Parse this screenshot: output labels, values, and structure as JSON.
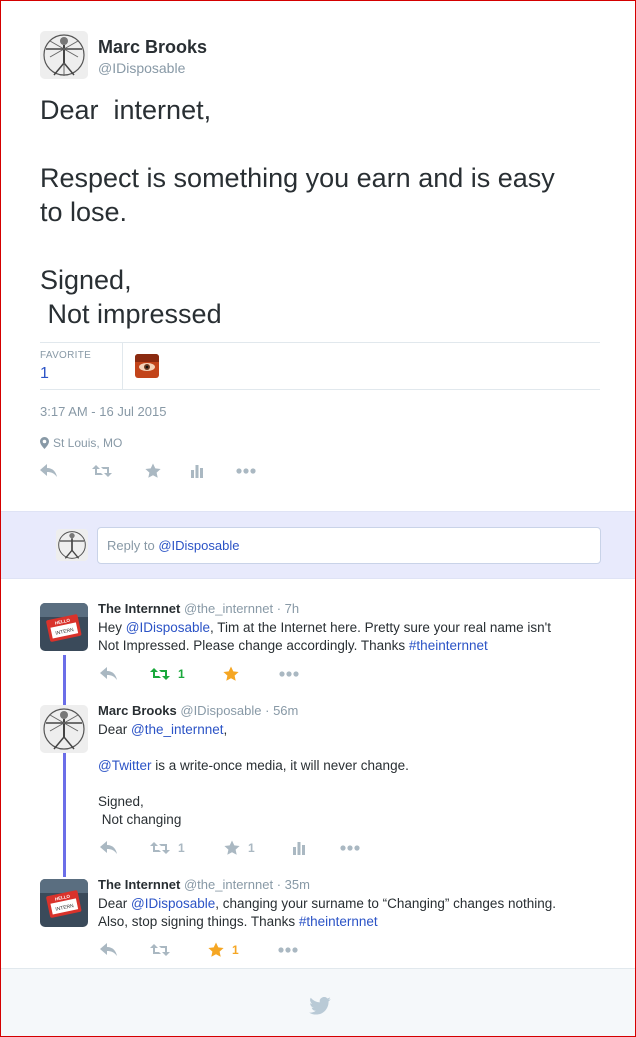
{
  "main_tweet": {
    "name": "Marc Brooks",
    "handle": "@IDisposable",
    "text": "Dear  internet,\n\nRespect is something you earn and is easy\nto lose.\n\nSigned,\n Not impressed",
    "favorite_label": "FAVORITE",
    "favorite_count": "1",
    "timestamp": "3:17 AM - 16 Jul 2015",
    "location": "St Louis, MO",
    "actions": [
      "reply-icon",
      "retweet-icon",
      "favorite-icon",
      "stats-icon",
      "more-icon"
    ]
  },
  "reply_box": {
    "prefix": "Reply to ",
    "mention": "@IDisposable"
  },
  "conversation": [
    {
      "name": "The Internnet",
      "handle": "@the_internnet",
      "time": "· 7h",
      "text_parts": [
        "Hey ",
        "@IDisposable",
        ", Tim at the Internet here. Pretty sure your real name isn't\nNot Impressed. Please change accordingly. Thanks ",
        "#theinternnet"
      ],
      "retweet_count": "1",
      "favorite_count": ""
    },
    {
      "name": "Marc Brooks",
      "handle": "@IDisposable",
      "time": "· 56m",
      "text_parts": [
        "Dear ",
        "@the_internnet",
        ",\n\n",
        "@Twitter",
        " is a write-once media, it will never change.\n\nSigned,\n Not changing"
      ],
      "retweet_count": "1",
      "favorite_count": "1"
    },
    {
      "name": "The Internnet",
      "handle": "@the_internnet",
      "time": "· 35m",
      "text_parts": [
        "Dear ",
        "@IDisposable",
        ", changing your surname to “Changing” changes nothing.\nAlso, stop signing things. Thanks ",
        "#theinternnet"
      ],
      "retweet_count": "",
      "favorite_count": "1"
    }
  ],
  "colors": {
    "link": "#2b53c6",
    "thread_line": "#6b6ee8",
    "retweet_active": "#19a83b",
    "favorite_active": "#f5a623",
    "reply_bar_bg": "#e8eafc"
  }
}
